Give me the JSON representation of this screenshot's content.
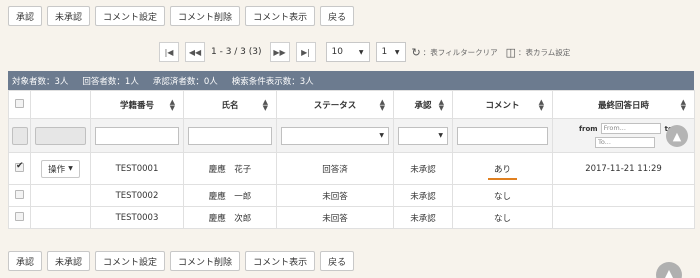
{
  "toolbar": {
    "approve": "承認",
    "unapprove": "未承認",
    "comment_set": "コメント設定",
    "comment_delete": "コメント削除",
    "comment_show": "コメント表示",
    "back": "戻る"
  },
  "pager": {
    "range_text": "1 - 3 / 3 (3)",
    "per_page": "10",
    "page": "1",
    "filter_clear": "：表フィルタークリア",
    "column_settings": "：表カラム設定"
  },
  "summary": {
    "target": "対象者数：3人",
    "answered": "回答者数：1人",
    "approved": "承認済者数：0人",
    "search_hits": "検索条件表示数：3人"
  },
  "table": {
    "headers": {
      "student_no": "学籍番号",
      "name": "氏名",
      "status": "ステータス",
      "approval": "承認",
      "comment": "コメント",
      "last_answered": "最終回答日時"
    },
    "date_filter": {
      "from_label": "from",
      "to_label": "to",
      "from_placeholder": "From...",
      "to_placeholder": "To..."
    },
    "op_button": "操作",
    "rows": [
      {
        "checked": true,
        "student_no": "TEST0001",
        "name": "慶應　花子",
        "status": "回答済",
        "approval": "未承認",
        "comment": "あり",
        "last_answered": "2017-11-21 11:29"
      },
      {
        "checked": false,
        "student_no": "TEST0002",
        "name": "慶應　一郎",
        "status": "未回答",
        "approval": "未承認",
        "comment": "なし",
        "last_answered": ""
      },
      {
        "checked": false,
        "student_no": "TEST0003",
        "name": "慶應　次郎",
        "status": "未回答",
        "approval": "未承認",
        "comment": "なし",
        "last_answered": ""
      }
    ]
  },
  "colors": {
    "info_bar": "#6c7b8f",
    "background": "#f7f3ec",
    "highlight_underline": "#e08020"
  }
}
